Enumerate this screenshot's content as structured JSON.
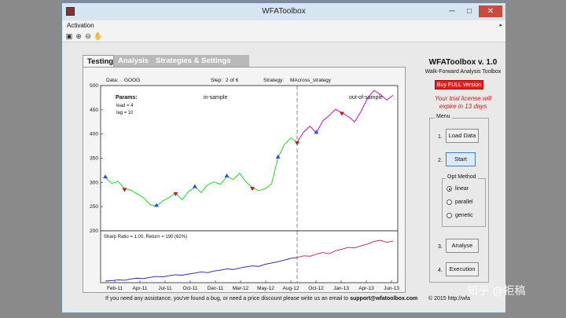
{
  "window": {
    "title": "WFAToolbox",
    "minimize": "─",
    "maximize": "□",
    "close": "✕"
  },
  "menubar": {
    "item": "Activation",
    "arrow": "▸"
  },
  "toolbar": {
    "icons": [
      "print-icon",
      "zoom-in-icon",
      "zoom-out-icon",
      "pan-icon"
    ]
  },
  "tabs": [
    {
      "label": "Testing"
    },
    {
      "label": "Analysis"
    },
    {
      "label": "Strategies & Settings"
    }
  ],
  "info": {
    "data_label": "Data:",
    "data_value": "GOOG",
    "step_label": "Step:",
    "step_value": "2 of 6",
    "strategy_label": "Strategy:",
    "strategy_value": "MAcross_strategy"
  },
  "params": {
    "title": "Params:",
    "lead": "lead = 4",
    "lag": "lag = 10"
  },
  "segments": {
    "in_sample": "in-sample",
    "out_of_sample": "out-of-sample"
  },
  "equity": {
    "annotation": "Sharp Ratio = 1.00, Return = 190 (62%)"
  },
  "chart_data": [
    {
      "type": "line",
      "ylim": [
        200,
        500
      ],
      "yticks": [
        "200",
        "250",
        "300",
        "350",
        "400",
        "450",
        "500"
      ],
      "split_index": 30,
      "series": [
        {
          "values": [
            310,
            298,
            302,
            287,
            284,
            276,
            268,
            254,
            251,
            262,
            269,
            278,
            264,
            281,
            290,
            279,
            295,
            301,
            296,
            312,
            306,
            319,
            301,
            289,
            283,
            287,
            297,
            351,
            378,
            392,
            383,
            404,
            416,
            402,
            427,
            438,
            451,
            444,
            436,
            425,
            447,
            474,
            490,
            482,
            470,
            480
          ]
        }
      ],
      "buy_markers": [
        0,
        8,
        14,
        19,
        27,
        33
      ],
      "sell_markers": [
        3,
        11,
        23,
        30,
        37
      ]
    },
    {
      "type": "line",
      "xticks": [
        "Feb-11",
        "Apr-11",
        "Jul-11",
        "Oct-11",
        "Dec-11",
        "Mar-12",
        "May-12",
        "Aug-12",
        "Oct-12",
        "Jan-13",
        "Apr-13",
        "Jun-13"
      ],
      "split_index": 30,
      "series": [
        {
          "values": [
            0,
            2,
            6,
            4,
            10,
            14,
            12,
            18,
            22,
            20,
            26,
            30,
            28,
            34,
            38,
            44,
            40,
            48,
            52,
            58,
            55,
            62,
            68,
            72,
            70,
            80,
            86,
            92,
            100,
            108,
            112,
            120,
            118,
            128,
            136,
            130,
            144,
            152,
            160,
            158,
            168,
            176,
            188,
            194,
            184,
            190
          ]
        }
      ]
    }
  ],
  "footer": {
    "help_text": "If you need any assistance, you've found a bug, or need a price discount please write us an email to",
    "email": "support@wfatoolbox.com",
    "copyright": "© 2015  http://wfa"
  },
  "right_panel": {
    "title": "WFAToolbox v. 1.0",
    "subtitle": "Walk-Forward Analysis Toolbox",
    "buy_label": "Buy FULL Version",
    "trial_line1": "Your trial license will",
    "trial_line2": "expire in 13 days",
    "menu_label": "Menu",
    "load_num": "1.",
    "load_label": "Load Data",
    "start_num": "2.",
    "start_label": "Start",
    "opt_label": "Opt Method",
    "opt_linear": "linear",
    "opt_parallel": "parallel",
    "opt_genetic": "genetic",
    "analyse_num": "3.",
    "analyse_label": "Analyse",
    "exec_num": "4.",
    "exec_label": "Execution"
  },
  "watermark": "知乎 @拒稿",
  "colors": {
    "in_sample": "#33dd33",
    "out_sample": "#cc22cc",
    "equity_in": "#1a1aa8",
    "equity_out": "#c02050",
    "buy": "#2a52e0",
    "sell": "#c01818",
    "accent": "#e02020"
  }
}
